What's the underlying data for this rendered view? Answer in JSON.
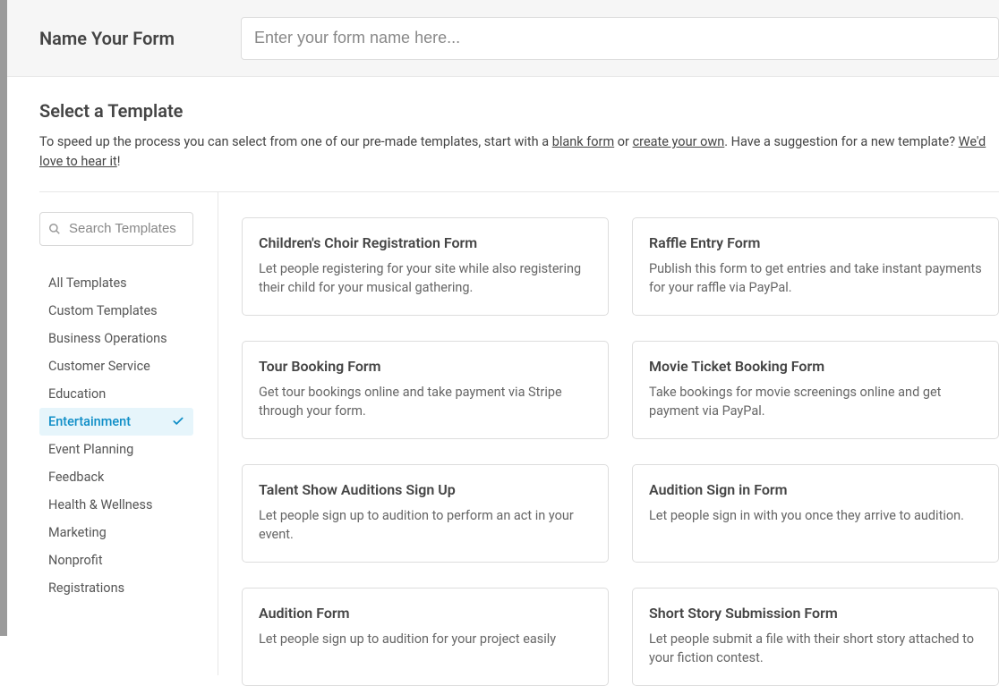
{
  "header": {
    "label": "Name Your Form",
    "placeholder": "Enter your form name here..."
  },
  "section": {
    "title": "Select a Template",
    "intro_pre": "To speed up the process you can select from one of our pre-made templates, start with a ",
    "blank_link": "blank form",
    "intro_or": " or ",
    "create_link": "create your own",
    "intro_suggest": ". Have a suggestion for a new template? ",
    "love_link": "We'd love to hear it",
    "intro_bang": "!"
  },
  "search": {
    "placeholder": "Search Templates"
  },
  "categories": [
    {
      "label": "All Templates",
      "active": false
    },
    {
      "label": "Custom Templates",
      "active": false
    },
    {
      "label": "Business Operations",
      "active": false
    },
    {
      "label": "Customer Service",
      "active": false
    },
    {
      "label": "Education",
      "active": false
    },
    {
      "label": "Entertainment",
      "active": true
    },
    {
      "label": "Event Planning",
      "active": false
    },
    {
      "label": "Feedback",
      "active": false
    },
    {
      "label": "Health & Wellness",
      "active": false
    },
    {
      "label": "Marketing",
      "active": false
    },
    {
      "label": "Nonprofit",
      "active": false
    },
    {
      "label": "Registrations",
      "active": false
    }
  ],
  "templates": [
    {
      "title": "Children's Choir Registration Form",
      "desc": "Let people registering for your site while also registering their child for your musical gathering."
    },
    {
      "title": "Raffle Entry Form",
      "desc": "Publish this form to get entries and take instant payments for your raffle via PayPal."
    },
    {
      "title": "Tour Booking Form",
      "desc": "Get tour bookings online and take payment via Stripe through your form."
    },
    {
      "title": "Movie Ticket Booking Form",
      "desc": "Take bookings for movie screenings online and get payment via PayPal."
    },
    {
      "title": "Talent Show Auditions Sign Up",
      "desc": "Let people sign up to audition to perform an act in your event."
    },
    {
      "title": "Audition Sign in Form",
      "desc": "Let people sign in with you once they arrive to audition."
    },
    {
      "title": "Audition Form",
      "desc": "Let people sign up to audition for your project easily"
    },
    {
      "title": "Short Story Submission Form",
      "desc": "Let people submit a file with their short story attached to your fiction contest."
    }
  ]
}
